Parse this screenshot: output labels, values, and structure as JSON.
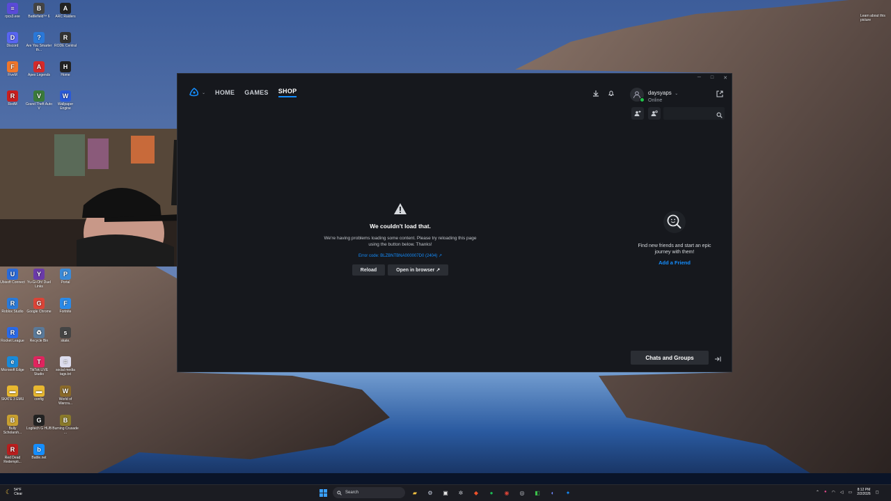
{
  "desktop": {
    "icons": [
      {
        "label": "rpcs3.exe",
        "color": "#5a4bd8",
        "glyph": "≡"
      },
      {
        "label": "Battlefield™ 6",
        "color": "#444",
        "glyph": "B"
      },
      {
        "label": "ARC Raiders",
        "color": "#222",
        "glyph": "A"
      },
      {
        "label": "Discord",
        "color": "#5865f2",
        "glyph": "D"
      },
      {
        "label": "Are You Smarter th...",
        "color": "#2a78d8",
        "glyph": "?"
      },
      {
        "label": "RODE Central",
        "color": "#333",
        "glyph": "R"
      },
      {
        "label": "FiveM",
        "color": "#f0762a",
        "glyph": "F"
      },
      {
        "label": "Apex Legends",
        "color": "#d42a2a",
        "glyph": "A"
      },
      {
        "label": "Home",
        "color": "#222",
        "glyph": "H"
      },
      {
        "label": "RedM",
        "color": "#c81e1e",
        "glyph": "R"
      },
      {
        "label": "Grand Theft Auto V",
        "color": "#3a7a3a",
        "glyph": "V"
      },
      {
        "label": "Wallpaper Engine",
        "color": "#2a5ad8",
        "glyph": "W"
      },
      {
        "label": "Ubisoft Connect",
        "color": "#2a6ad8",
        "glyph": "U"
      },
      {
        "label": "Yu-Gi-Oh! Duel Links",
        "color": "#6a3aa8",
        "glyph": "Y"
      },
      {
        "label": "Portal",
        "color": "#3a8ad8",
        "glyph": "P"
      },
      {
        "label": "Roblox Studio",
        "color": "#2a7ad8",
        "glyph": "R"
      },
      {
        "label": "Google Chrome",
        "color": "#db4437",
        "glyph": "G"
      },
      {
        "label": "Fortnite",
        "color": "#2a8ae8",
        "glyph": "F"
      },
      {
        "label": "Rocket League",
        "color": "#2a6ae8",
        "glyph": "R"
      },
      {
        "label": "Recycle Bin",
        "color": "#5a7a9a",
        "glyph": "♻"
      },
      {
        "label": "skate.",
        "color": "#444",
        "glyph": "s"
      },
      {
        "label": "Microsoft Edge",
        "color": "#1a8ad8",
        "glyph": "e"
      },
      {
        "label": "TikTok LIVE Studio",
        "color": "#e0245e",
        "glyph": "T"
      },
      {
        "label": "social media tags.txt",
        "color": "#dde",
        "glyph": "≡"
      },
      {
        "label": "SKATE 3 EMU",
        "color": "#e8b830",
        "glyph": "▬"
      },
      {
        "label": "config",
        "color": "#e8b830",
        "glyph": "▬"
      },
      {
        "label": "World of Warcra...",
        "color": "#8a6a2a",
        "glyph": "W"
      },
      {
        "label": "Bully Scholarsh...",
        "color": "#c8a030",
        "glyph": "B"
      },
      {
        "label": "Logitech G HUB",
        "color": "#222",
        "glyph": "G"
      },
      {
        "label": "Burning Crusade ...",
        "color": "#8a7a2a",
        "glyph": "B"
      },
      {
        "label": "Red Dead Redempti...",
        "color": "#b81e1e",
        "glyph": "R"
      },
      {
        "label": "Battle.net",
        "color": "#148eff",
        "glyph": "b"
      }
    ],
    "corner_note": "Learn about this picture"
  },
  "bnet": {
    "nav": {
      "home": "HOME",
      "games": "GAMES",
      "shop": "SHOP"
    },
    "profile": {
      "username": "daysyaps",
      "status": "Online"
    },
    "search": {
      "placeholder": ""
    },
    "error": {
      "title": "We couldn't load that.",
      "body": "We're having problems loading some content. Please try reloading this page using the button below. Thanks!",
      "code": "Error code: BLZBNTBNA000007D0 (2404) ↗",
      "reload": "Reload",
      "open_browser": "Open in browser ↗"
    },
    "friends": {
      "empty_text": "Find new friends and start an epic journey with them!",
      "add_friend": "Add a Friend"
    },
    "chats": "Chats and Groups",
    "accent": "#148eff"
  },
  "taskbar": {
    "weather_temp": "54°F",
    "weather_cond": "Clear",
    "search_label": "Search",
    "time": "8:12 PM",
    "date": "2/2/2026"
  }
}
